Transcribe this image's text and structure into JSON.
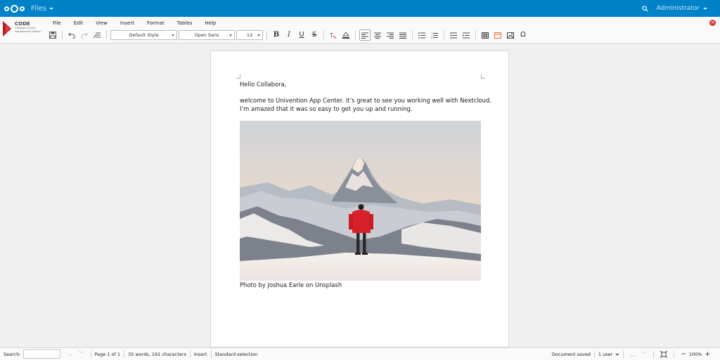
{
  "topbar": {
    "app_name": "Files",
    "user_name": "Administrator",
    "brand_color": "#0082c9"
  },
  "logo": {
    "title": "CODE",
    "line1": "Collabora Online",
    "line2": "Development Edition"
  },
  "menu": {
    "items": [
      "File",
      "Edit",
      "View",
      "Insert",
      "Format",
      "Tables",
      "Help"
    ]
  },
  "toolbar": {
    "style_value": "Default Style",
    "font_value": "Open Sans",
    "size_value": "12"
  },
  "document": {
    "greeting": "Hello Collabora,",
    "line1": "welcome to Univention App Center. It’s great to see you working well with Nextcloud.",
    "line2": "I’m amazed that it was so easy to get you up and running.",
    "caption": "Photo by Joshua Earle on Unsplash"
  },
  "status": {
    "search_label": "Search:",
    "page_info": "Page 1 of 1",
    "word_count": "35 words, 191 characters",
    "insert_mode": "Insert",
    "selection_mode": "Standard selection",
    "doc_state": "Document saved",
    "users": "1 user",
    "zoom": "100%"
  }
}
